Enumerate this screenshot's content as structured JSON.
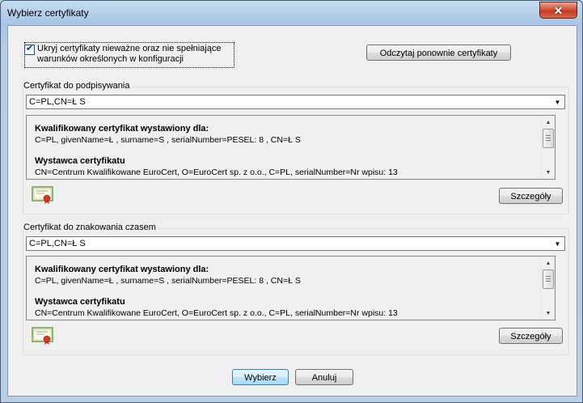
{
  "window": {
    "title": "Wybierz certyfikaty",
    "close_glyph": "✕"
  },
  "options": {
    "hide_invalid_label": "Ukryj certyfikaty nieważne oraz nie spełniające warunków określonych w konfiguracji",
    "hide_invalid_checked": true,
    "reload_button": "Odczytaj ponownie certyfikaty"
  },
  "signing": {
    "group_label": "Certyfikat do podpisywania",
    "selected": "C=PL,CN=Ł            S",
    "subject_heading": "Kwalifikowany certyfikat wystawiony dla:",
    "subject_text": "C=PL, givenName=Ł           , surname=S            , serialNumber=PESEL: 8                    , CN=Ł           S",
    "issuer_heading": "Wystawca certyfikatu",
    "issuer_text": "CN=Centrum Kwalifikowane EuroCert, O=EuroCert sp. z o.o., C=PL, serialNumber=Nr wpisu: 13",
    "details_button": "Szczegóły"
  },
  "timestamp": {
    "group_label": "Certyfikat do znakowania czasem",
    "selected": "C=PL,CN=Ł            S",
    "subject_heading": "Kwalifikowany certyfikat wystawiony dla:",
    "subject_text": "C=PL, givenName=Ł           , surname=S            , serialNumber=PESEL: 8                    , CN=Ł           S",
    "issuer_heading": "Wystawca certyfikatu",
    "issuer_text": "CN=Centrum Kwalifikowane EuroCert, O=EuroCert sp. z o.o., C=PL, serialNumber=Nr wpisu: 13",
    "details_button": "Szczegóły"
  },
  "footer": {
    "ok_button": "Wybierz",
    "cancel_button": "Anuluj"
  },
  "icons": {
    "checkbox_mark": "✔",
    "combo_arrow": "▼",
    "scroll_up": "▲",
    "scroll_down": "▼",
    "certificate": "certificate-icon"
  },
  "colors": {
    "title_bar": "#a9c6e6",
    "close_button": "#c43a1f",
    "default_button_border": "#3c7fb1"
  }
}
